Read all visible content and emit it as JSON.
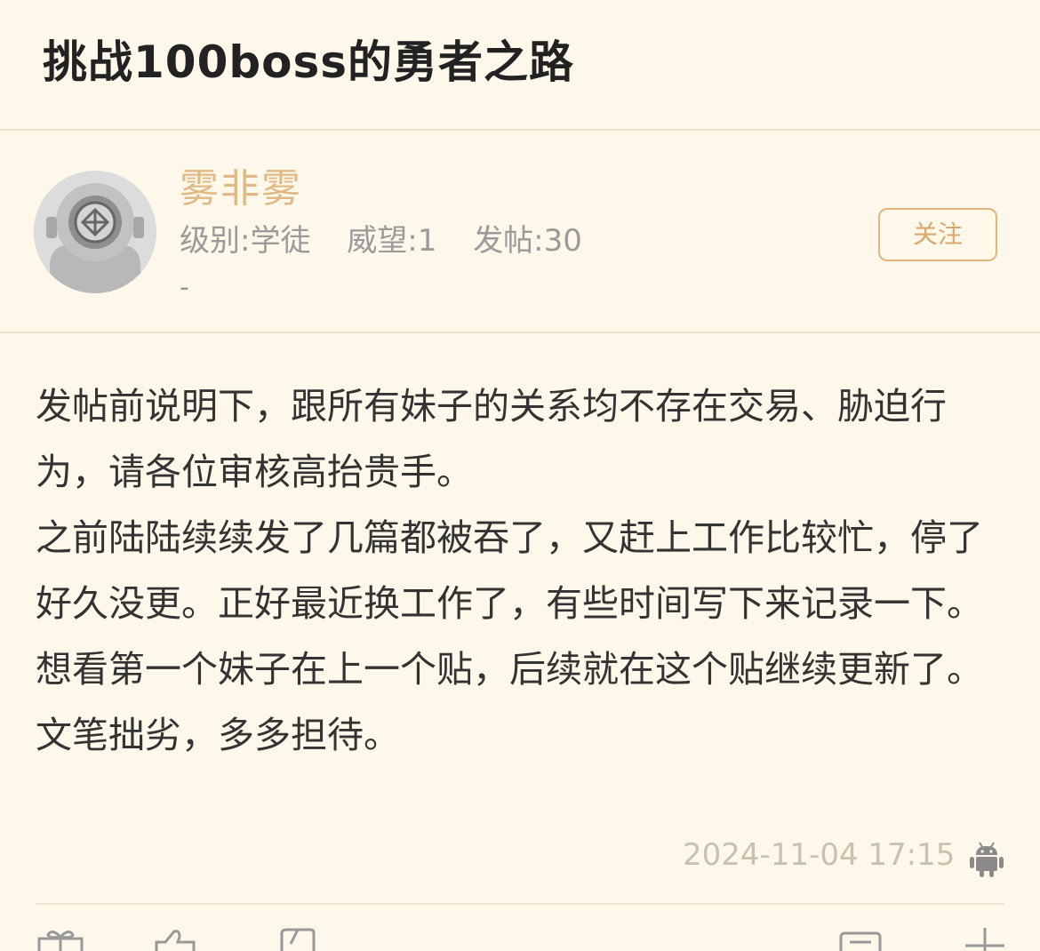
{
  "post": {
    "title": "挑战100boss的勇者之路"
  },
  "author": {
    "name": "雾非雾",
    "level": "级别:学徒",
    "prestige": "威望:1",
    "posts": "发帖:30",
    "signature": "-",
    "follow_label": "关注",
    "avatar_icon": "diver-helmet-avatar"
  },
  "content": {
    "paragraphs": [
      "发帖前说明下，跟所有妹子的关系均不存在交易、胁迫行为，请各位审核高抬贵手。",
      "之前陆陆续续发了几篇都被吞了，又赶上工作比较忙，停了好久没更。正好最近换工作了，有些时间写下来记录一下。想看第一个妹子在上一个贴，后续就在这个贴继续更新了。文笔拙劣，多多担待。"
    ]
  },
  "meta": {
    "timestamp": "2024-11-04 17:15",
    "device_icon": "android-icon"
  },
  "toolbar": {
    "icons": [
      "gift-icon",
      "thumbs-up-icon",
      "favorite-icon",
      "comment-icon",
      "add-icon"
    ]
  },
  "colors": {
    "background": "#fdf8e9",
    "username": "#e0ba86",
    "follow_border": "#e2b77f",
    "meta_text": "#c8c0b0"
  }
}
